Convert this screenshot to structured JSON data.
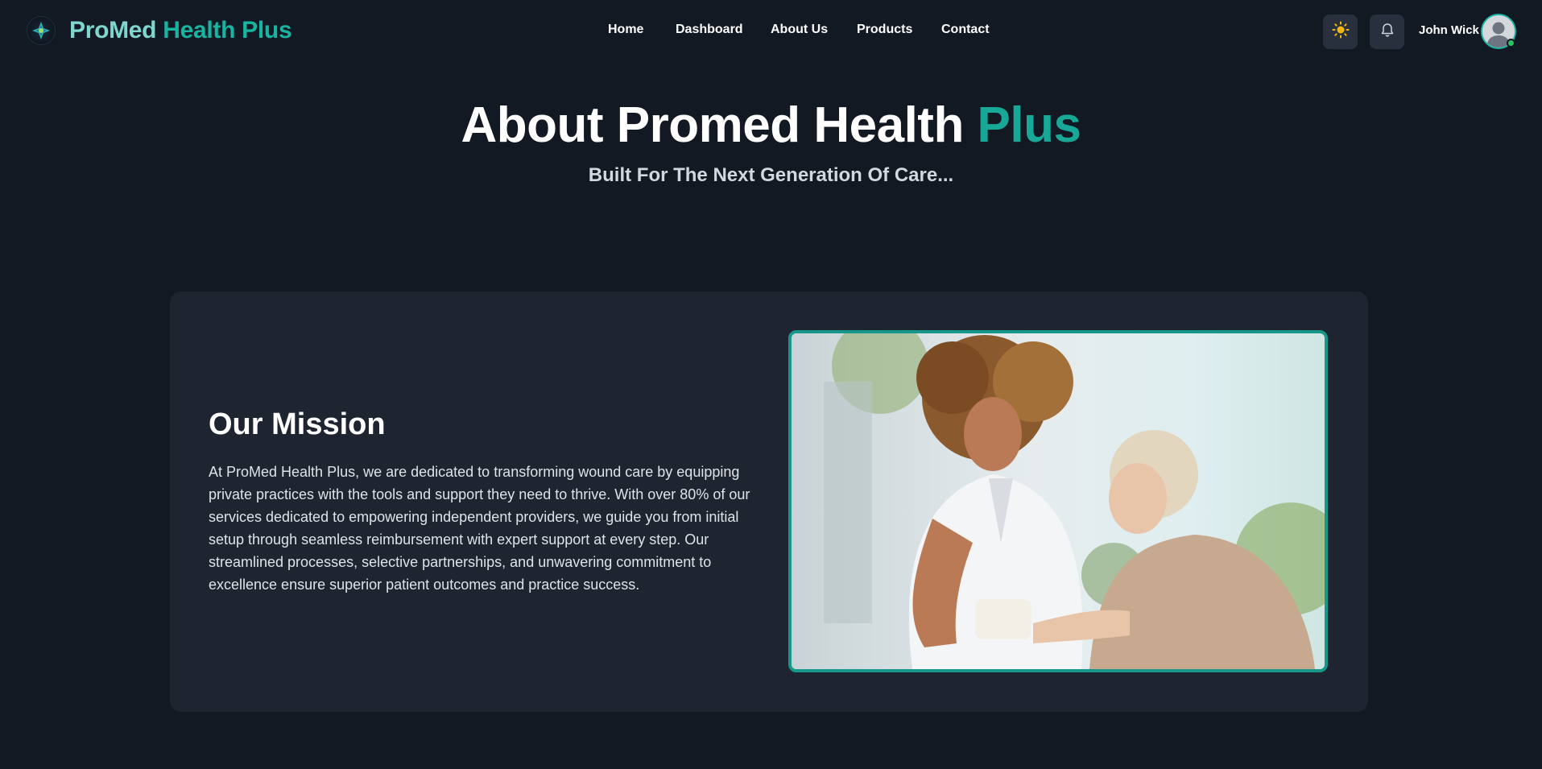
{
  "brand": {
    "name_part1": "ProMed",
    "name_part2": "Health Plus",
    "logo_icon": "caduceus-logo-icon"
  },
  "nav": {
    "items": [
      "Home",
      "Dashboard",
      "About Us",
      "Products",
      "Contact"
    ]
  },
  "header": {
    "theme_icon": "sun-icon",
    "notification_icon": "bell-icon",
    "user_name": "John Wick",
    "avatar_icon": "user-avatar-icon",
    "status_color": "#22c55e"
  },
  "hero": {
    "title_main": "About Promed Health ",
    "title_accent": "Plus",
    "subtitle": "Built For The Next Generation Of Care..."
  },
  "mission": {
    "title": "Our Mission",
    "body": "At ProMed Health Plus, we are dedicated to transforming wound care by equipping private practices with the tools and support they need to thrive. With over 80% of our services dedicated to empowering independent providers, we guide you from initial setup through seamless reimbursement with expert support at every step. Our streamlined processes, selective partnerships, and unwavering commitment to excellence ensure superior patient outcomes and practice success.",
    "image_icon": "nurse-bandaging-patient-photo"
  },
  "colors": {
    "background": "#131923",
    "card": "#1e2531",
    "accent": "#19b3a1",
    "icon_button": "#27303c"
  }
}
